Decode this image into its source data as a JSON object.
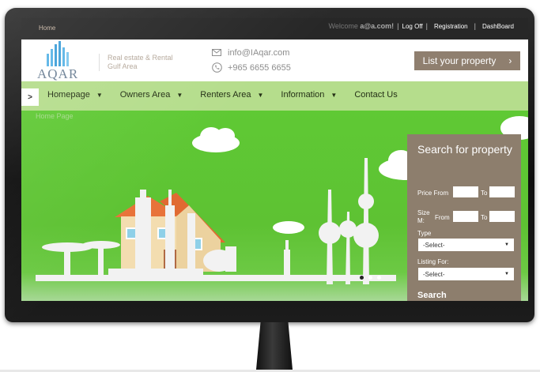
{
  "topbar": {
    "home": "Home",
    "welcome_prefix": "Welcome ",
    "welcome_user": "a@a.com!",
    "logoff": "Log Off",
    "registration": "Registration",
    "dashboard": "DashBoard"
  },
  "header": {
    "logo_text": "AQAR",
    "tagline": "Real estate & Rental Gulf Area",
    "email": "info@IAqar.com",
    "phone": "+965 6655 6655",
    "list_button": "List your property",
    "list_button_arrow": "›"
  },
  "nav": {
    "toggle": ">",
    "items": [
      {
        "label": "Homepage",
        "caret": "▼"
      },
      {
        "label": "Owners Area",
        "caret": "▼"
      },
      {
        "label": "Renters Area",
        "caret": "▼"
      },
      {
        "label": "Information",
        "caret": "▼"
      },
      {
        "label": "Contact Us",
        "caret": ""
      }
    ]
  },
  "hero": {
    "breadcrumb": "Home Page",
    "slides": 3,
    "active_slide": 1
  },
  "search": {
    "title": "Search for property",
    "price_from_label": "Price From",
    "price_to_label": "To",
    "size_label": "Size M:",
    "size_from_label": "From",
    "size_to_label": "To",
    "type_label": "Type",
    "type_value": "-Select-",
    "listing_label": "Listing For:",
    "listing_value": "-Select-",
    "button": "Search"
  },
  "colors": {
    "topbar": "#272727",
    "brand_brown": "#8f7f6f",
    "nav_green": "#b5dd8c",
    "hero_green": "#5fc934",
    "logo_blue": "#5ab4e6"
  },
  "icons": {
    "email": "envelope-icon",
    "phone": "phone-icon",
    "select_arrow": "▼"
  }
}
